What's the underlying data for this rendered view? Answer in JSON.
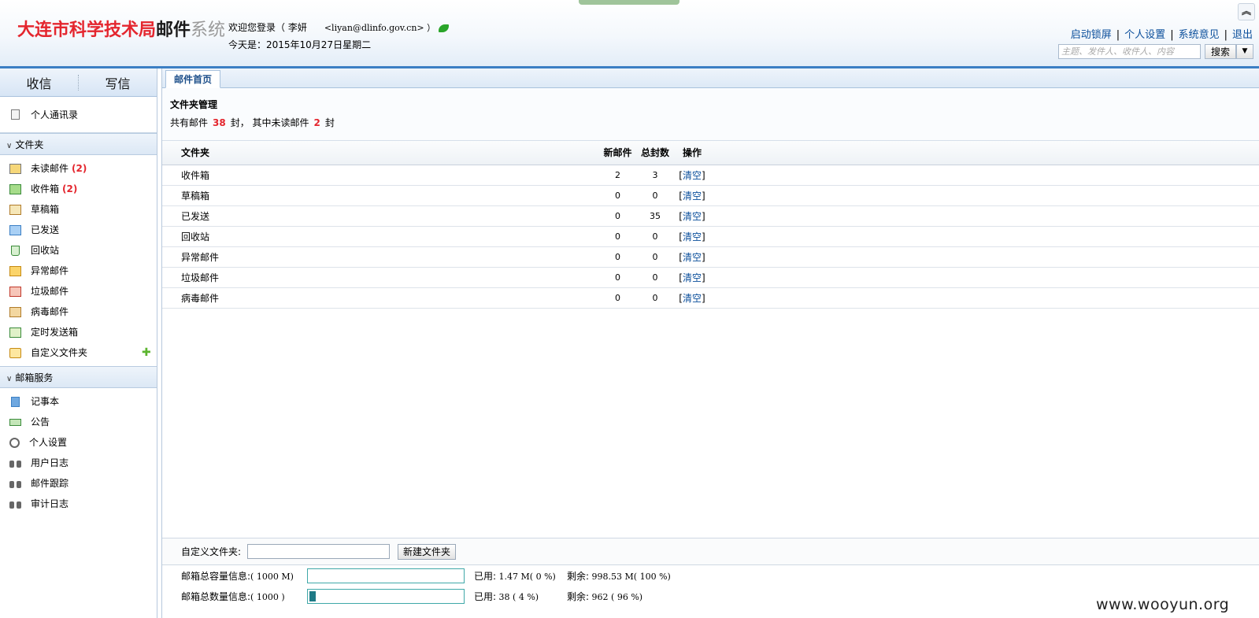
{
  "header": {
    "logo": {
      "part1": "大连市科学技术局",
      "part2": "邮件",
      "part3": "系统"
    },
    "welcome_prefix": "欢迎您登录（ 李妍",
    "email": "<liyan@dlinfo.gov.cn> ）",
    "today": "今天是：2015年10月27日星期二",
    "links": {
      "lock": "启动锁屏",
      "personal": "个人设置",
      "feedback": "系统意见",
      "logout": "退出"
    },
    "search": {
      "placeholder": "主题、发件人、收件人、内容",
      "button": "搜索"
    }
  },
  "sidebar": {
    "receive": "收信",
    "compose": "写信",
    "contacts": "个人通讯录",
    "folders_title": "文件夹",
    "folders": [
      {
        "label": "未读邮件",
        "count": "(2)",
        "icon": "unread-mail-icon"
      },
      {
        "label": "收件箱",
        "count": "(2)",
        "icon": "inbox-icon"
      },
      {
        "label": "草稿箱",
        "count": "",
        "icon": "draft-icon"
      },
      {
        "label": "已发送",
        "count": "",
        "icon": "sent-icon"
      },
      {
        "label": "回收站",
        "count": "",
        "icon": "recycle-bin-icon"
      },
      {
        "label": "异常邮件",
        "count": "",
        "icon": "abnormal-mail-icon"
      },
      {
        "label": "垃圾邮件",
        "count": "",
        "icon": "spam-icon"
      },
      {
        "label": "病毒邮件",
        "count": "",
        "icon": "virus-mail-icon"
      },
      {
        "label": "定时发送箱",
        "count": "",
        "icon": "scheduled-send-icon"
      },
      {
        "label": "自定义文件夹",
        "count": "",
        "icon": "folder-icon"
      }
    ],
    "add_folder_symbol": "✚",
    "services_title": "邮箱服务",
    "services": [
      {
        "label": "记事本",
        "icon": "notepad-icon"
      },
      {
        "label": "公告",
        "icon": "announcement-icon"
      },
      {
        "label": "个人设置",
        "icon": "gear-icon"
      },
      {
        "label": "用户日志",
        "icon": "binoculars-icon"
      },
      {
        "label": "邮件跟踪",
        "icon": "binoculars-icon"
      },
      {
        "label": "审计日志",
        "icon": "binoculars-icon"
      }
    ]
  },
  "main": {
    "tab": "邮件首页",
    "folder_mgmt": {
      "title": "文件夹管理",
      "summary_prefix": "共有邮件",
      "total": "38",
      "summary_mid": "封， 其中未读邮件",
      "unread": "2",
      "summary_suffix": "封"
    },
    "table": {
      "headers": {
        "folder": "文件夹",
        "new": "新邮件",
        "total": "总封数",
        "op": "操作"
      },
      "rows": [
        {
          "folder": "收件箱",
          "new": "2",
          "total": "3",
          "op": "清空"
        },
        {
          "folder": "草稿箱",
          "new": "0",
          "total": "0",
          "op": "清空"
        },
        {
          "folder": "已发送",
          "new": "0",
          "total": "35",
          "op": "清空"
        },
        {
          "folder": "回收站",
          "new": "0",
          "total": "0",
          "op": "清空"
        },
        {
          "folder": "异常邮件",
          "new": "0",
          "total": "0",
          "op": "清空"
        },
        {
          "folder": "垃圾邮件",
          "new": "0",
          "total": "0",
          "op": "清空"
        },
        {
          "folder": "病毒邮件",
          "new": "0",
          "total": "0",
          "op": "清空"
        }
      ]
    },
    "custom_folder": {
      "label": "自定义文件夹:",
      "value": "",
      "button": "新建文件夹"
    },
    "quota": [
      {
        "label": "邮箱总容量信息:",
        "total": "( 1000 M)",
        "used_label": "已用:",
        "used": "1.47 M( 0 %)",
        "left_label": "剩余:",
        "left": "998.53 M( 100 %)",
        "fill_percent": 0
      },
      {
        "label": "邮箱总数量信息:",
        "total": "( 1000 )",
        "used_label": "已用:",
        "used": "38 ( 4 %)",
        "left_label": "剩余:",
        "left": "962 ( 96 %)",
        "fill_percent": 4
      }
    ]
  },
  "watermark": "www.wooyun.org"
}
